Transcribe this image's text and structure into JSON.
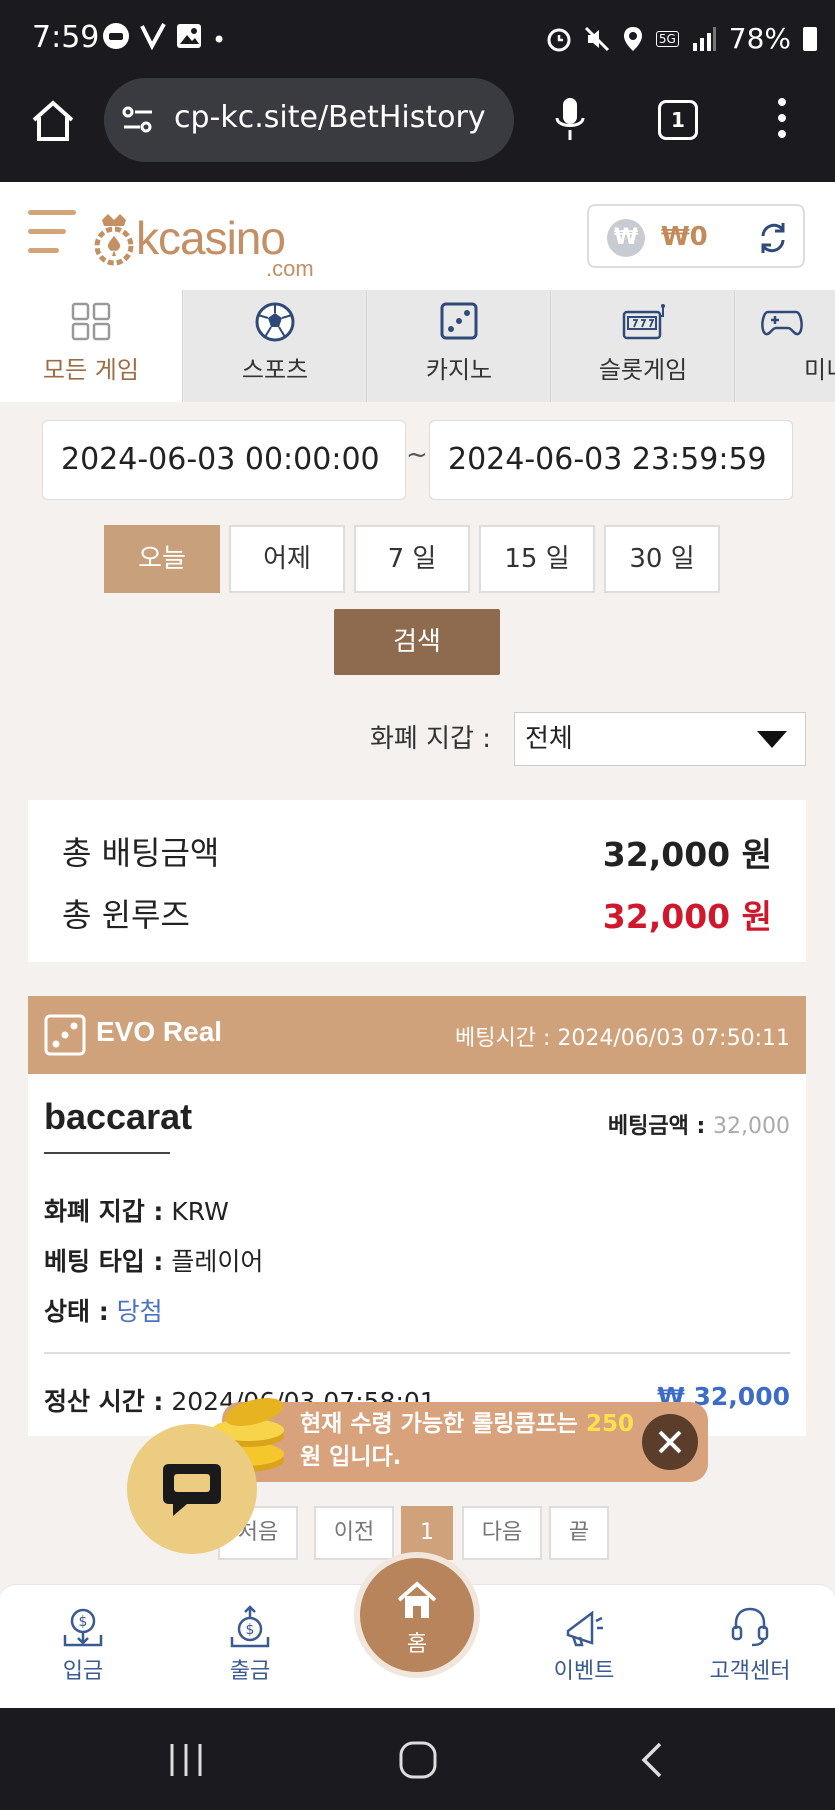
{
  "status_bar": {
    "time": "7:59",
    "network": "5G",
    "battery": "78%"
  },
  "browser": {
    "url": "cp-kc.site/BetHistory",
    "tab_count": "1"
  },
  "header": {
    "logo_text": "kcasino",
    "logo_suffix": ".com",
    "balance": "₩0",
    "currency_symbol": "₩"
  },
  "categories": [
    {
      "label": "모든 게임",
      "icon": "grid-icon",
      "active": true
    },
    {
      "label": "스포츠",
      "icon": "soccer-ball-icon"
    },
    {
      "label": "카지노",
      "icon": "dice-icon"
    },
    {
      "label": "슬롯게임",
      "icon": "slot-machine-icon"
    },
    {
      "label": "미니",
      "icon": "gamepad-icon"
    }
  ],
  "filters": {
    "date_from": "2024-06-03 00:00:00",
    "date_to": "2024-06-03 23:59:59",
    "separator": "~",
    "quick_ranges": [
      "오늘",
      "어제",
      "7 일",
      "15 일",
      "30 일"
    ],
    "search_label": "검색",
    "wallet_label": "화폐 지갑 :",
    "wallet_value": "전체"
  },
  "summary": {
    "total_bet_label": "총 배팅금액",
    "total_bet_value": "32,000 원",
    "total_winlose_label": "총 윈루즈",
    "total_winlose_value": "32,000 원"
  },
  "bet": {
    "provider": "EVO Real",
    "bet_time_label": "베팅시간 :",
    "bet_time": "2024/06/03 07:50:11",
    "game": "baccarat",
    "bet_amount_label": "베팅금액 :",
    "bet_amount": "32,000",
    "currency_label": "화폐 지갑 :",
    "currency": "KRW",
    "bet_type_label": "베팅 타입 :",
    "bet_type": "플레이어",
    "status_label": "상태 :",
    "status": "당첨",
    "settle_label": "정산 시간 :",
    "settle_time": "2024/06/03 07:58:01",
    "payout": "₩ 32,000"
  },
  "toast": {
    "prefix": "현재 수령 가능한 롤링콤프는 ",
    "amount": "250",
    "suffix": " 원 입니다."
  },
  "pagination": {
    "first": "처음",
    "prev": "이전",
    "current": "1",
    "next": "다음",
    "last": "끝"
  },
  "bottom_nav": {
    "deposit": "입금",
    "withdraw": "출금",
    "home": "홈",
    "event": "이벤트",
    "support": "고객센터"
  },
  "colors": {
    "accent": "#c9a07c",
    "search": "#8e6b4e",
    "loss_red": "#d0182c",
    "win_blue": "#4a72c4"
  }
}
